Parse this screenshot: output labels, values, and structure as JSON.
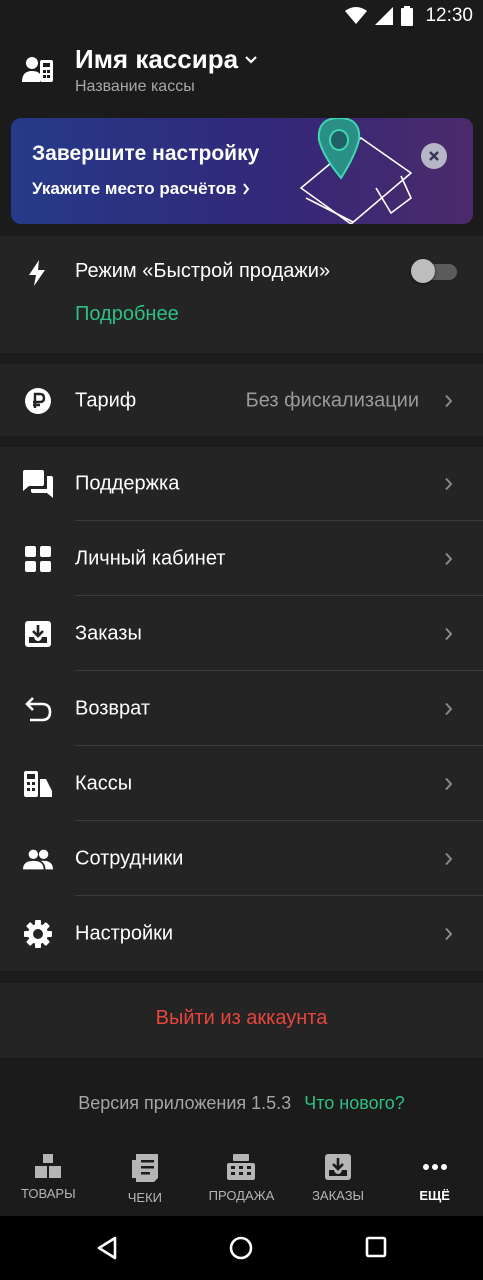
{
  "status_bar": {
    "time": "12:30"
  },
  "header": {
    "title": "Имя кассира",
    "subtitle": "Название кассы"
  },
  "banner": {
    "title": "Завершите настройку",
    "link": "Укажите место расчётов"
  },
  "quick_sale": {
    "label": "Режим «Быстрой продажи»",
    "more": "Подробнее",
    "enabled": false
  },
  "tariff": {
    "label": "Тариф",
    "value": "Без фискализации"
  },
  "menu": {
    "support": "Поддержка",
    "account": "Личный кабинет",
    "orders": "Заказы",
    "refund": "Возврат",
    "registers": "Кассы",
    "staff": "Сотрудники",
    "settings": "Настройки"
  },
  "logout": "Выйти из аккаунта",
  "version": {
    "text": "Версия приложения 1.5.3",
    "link": "Что нового?"
  },
  "bottom_nav": {
    "goods": "ТОВАРЫ",
    "receipts": "ЧЕКИ",
    "sale": "ПРОДАЖА",
    "orders": "ЗАКАЗЫ",
    "more": "ЕЩЁ",
    "active": "more"
  },
  "colors": {
    "accent_green": "#2fbf85",
    "logout_red": "#e8453c",
    "background": "#1b1b1b",
    "card": "#242424"
  }
}
